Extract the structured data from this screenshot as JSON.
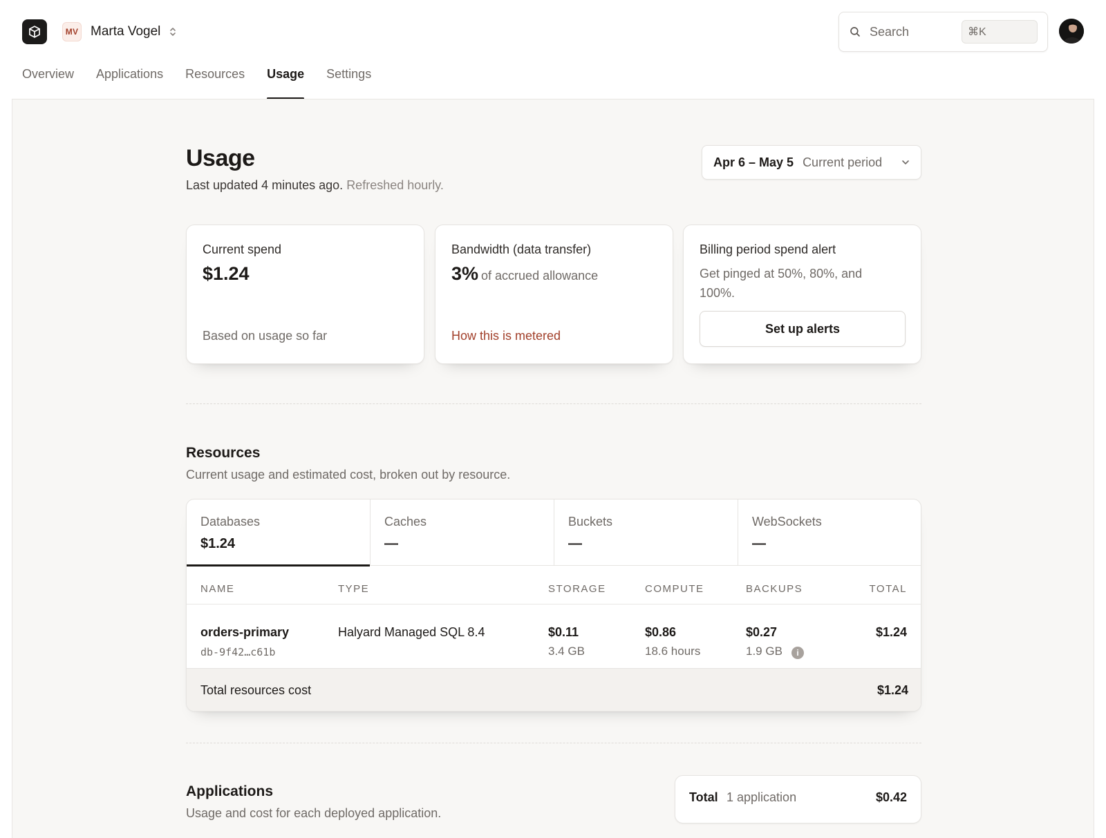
{
  "header": {
    "team": {
      "initials": "MV",
      "name": "Marta Vogel"
    },
    "search": {
      "placeholder": "Search",
      "shortcut": "⌘K"
    }
  },
  "nav": {
    "tabs": [
      {
        "label": "Overview"
      },
      {
        "label": "Applications"
      },
      {
        "label": "Resources"
      },
      {
        "label": "Usage",
        "active": true
      },
      {
        "label": "Settings"
      }
    ]
  },
  "page": {
    "title": "Usage",
    "updated": "Last updated 4 minutes ago.",
    "refresh_note": "Refreshed hourly.",
    "period": {
      "range": "Apr 6 – May 5",
      "label": "Current period"
    }
  },
  "cards": {
    "spend": {
      "title": "Current spend",
      "value": "$1.24",
      "note": "Based on usage so far"
    },
    "bandwidth": {
      "title": "Bandwidth (data transfer)",
      "value": "3%",
      "value_suffix": "of accrued allowance",
      "link": "How this is metered"
    },
    "alert": {
      "title": "Billing period spend alert",
      "description": "Get pinged at 50%, 80%, and 100%.",
      "button": "Set up alerts"
    }
  },
  "resources": {
    "title": "Resources",
    "subtitle": "Current usage and estimated cost, broken out by resource.",
    "tabs": [
      {
        "label": "Databases",
        "value": "$1.24",
        "active": true
      },
      {
        "label": "Caches",
        "value": "—"
      },
      {
        "label": "Buckets",
        "value": "—"
      },
      {
        "label": "WebSockets",
        "value": "—"
      }
    ],
    "columns": {
      "name": "NAME",
      "type": "TYPE",
      "storage": "STORAGE",
      "compute": "COMPUTE",
      "backups": "BACKUPS",
      "total": "TOTAL"
    },
    "rows": [
      {
        "name": "orders-primary",
        "id": "db-9f42…c61b",
        "type": "Halyard Managed SQL 8.4",
        "storage": {
          "cost": "$0.11",
          "amount": "3.4 GB"
        },
        "compute": {
          "cost": "$0.86",
          "amount": "18.6 hours"
        },
        "backups": {
          "cost": "$0.27",
          "amount": "1.9 GB"
        },
        "total": "$1.24"
      }
    ],
    "total": {
      "label": "Total resources cost",
      "value": "$1.24"
    }
  },
  "applications": {
    "title": "Applications",
    "subtitle": "Usage and cost for each deployed application.",
    "total": {
      "label": "Total",
      "count": "1 application",
      "value": "$0.42"
    }
  },
  "colors": {
    "accent_link": "#a2402b",
    "logo_bg": "#1c1b1a",
    "panel_bg": "#f8f7f5"
  },
  "icons": [
    "cube-icon",
    "updown-chevron-icon",
    "search-icon",
    "chevron-down-icon",
    "info-icon"
  ]
}
